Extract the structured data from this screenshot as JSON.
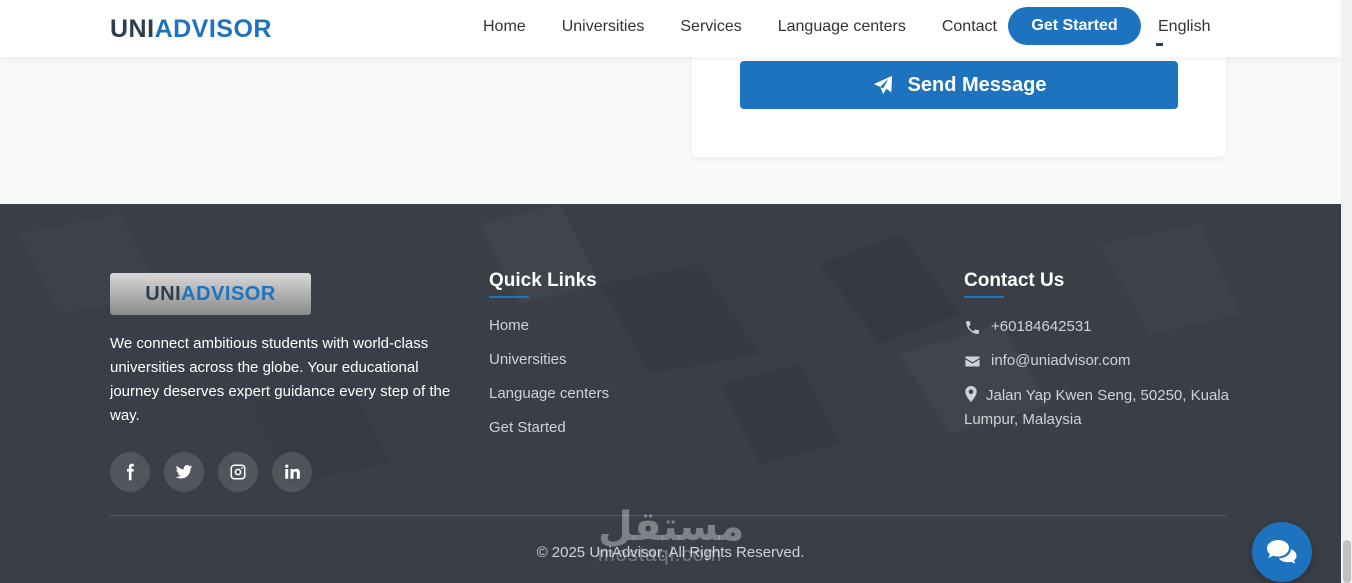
{
  "header": {
    "logo_main": "UNI",
    "logo_accent": "ADVIS",
    "logo_o": "O",
    "logo_end": "R",
    "nav": [
      "Home",
      "Universities",
      "Services",
      "Language centers",
      "Contact"
    ],
    "cta": "Get Started",
    "language": "English"
  },
  "form": {
    "send_label": "Send Message"
  },
  "footer": {
    "logo_main": "UNI",
    "logo_accent": "ADVISOR",
    "about": "We connect ambitious students with world-class universities across the globe. Your educational journey deserves expert guidance every step of the way.",
    "quick_links_title": "Quick Links",
    "quick_links": [
      "Home",
      "Universities",
      "Language centers",
      "Get Started"
    ],
    "contact_title": "Contact Us",
    "phone": "+60184642531",
    "email": "info@uniadvisor.com",
    "address": "Jalan Yap Kwen Seng, 50250, Kuala Lumpur, Malaysia",
    "copyright": "© 2025 UniAdvisor. All Rights Reserved.",
    "socials": [
      "facebook-icon",
      "twitter-icon",
      "instagram-icon",
      "linkedin-icon"
    ]
  },
  "watermark": {
    "arabic": "مستقل",
    "latin": "mostaql.com"
  },
  "colors": {
    "primary": "#1e73be",
    "footer_bg": "#3a3f47",
    "text_dark": "#2c3e50"
  }
}
